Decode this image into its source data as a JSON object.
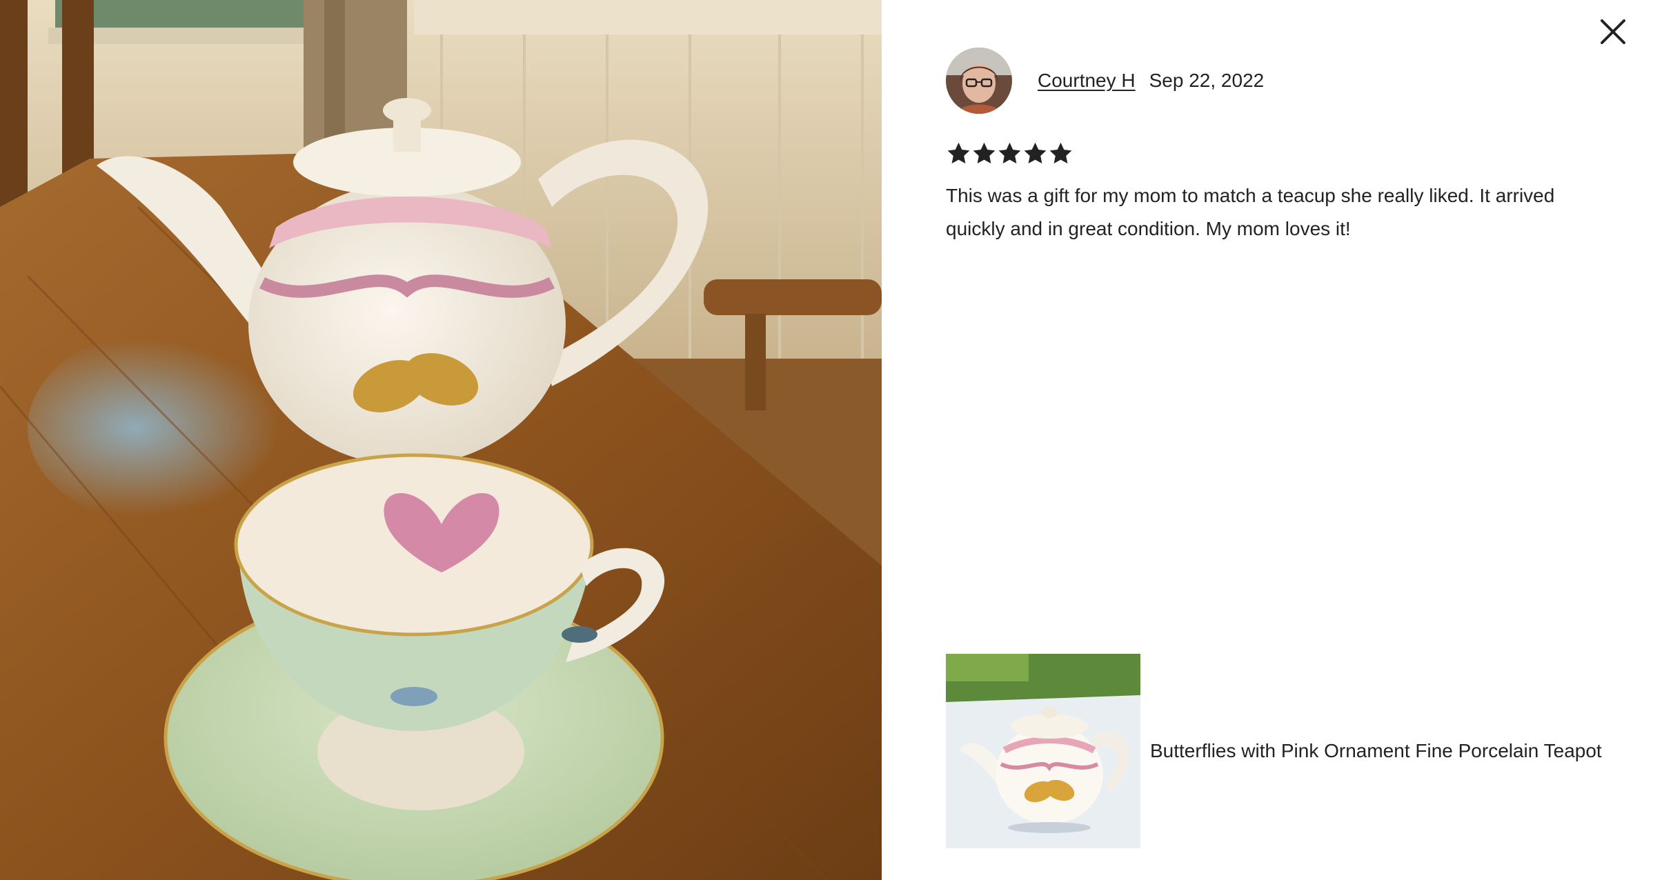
{
  "close_button": {
    "icon": "close-icon",
    "label": "Close"
  },
  "photo": {
    "description_icon": "review-photo"
  },
  "review": {
    "reviewer_name": "Courtney H",
    "date": "Sep 22, 2022",
    "rating": 5,
    "rating_max": 5,
    "text": "This was a gift for my mom to match a teacup she really liked. It arrived quickly and in great condition. My mom loves it!"
  },
  "listing": {
    "title": "Butterflies with Pink Ornament Fine Porcelain Teapot"
  },
  "colors": {
    "text": "#222222",
    "star": "#222222",
    "background": "#ffffff"
  }
}
